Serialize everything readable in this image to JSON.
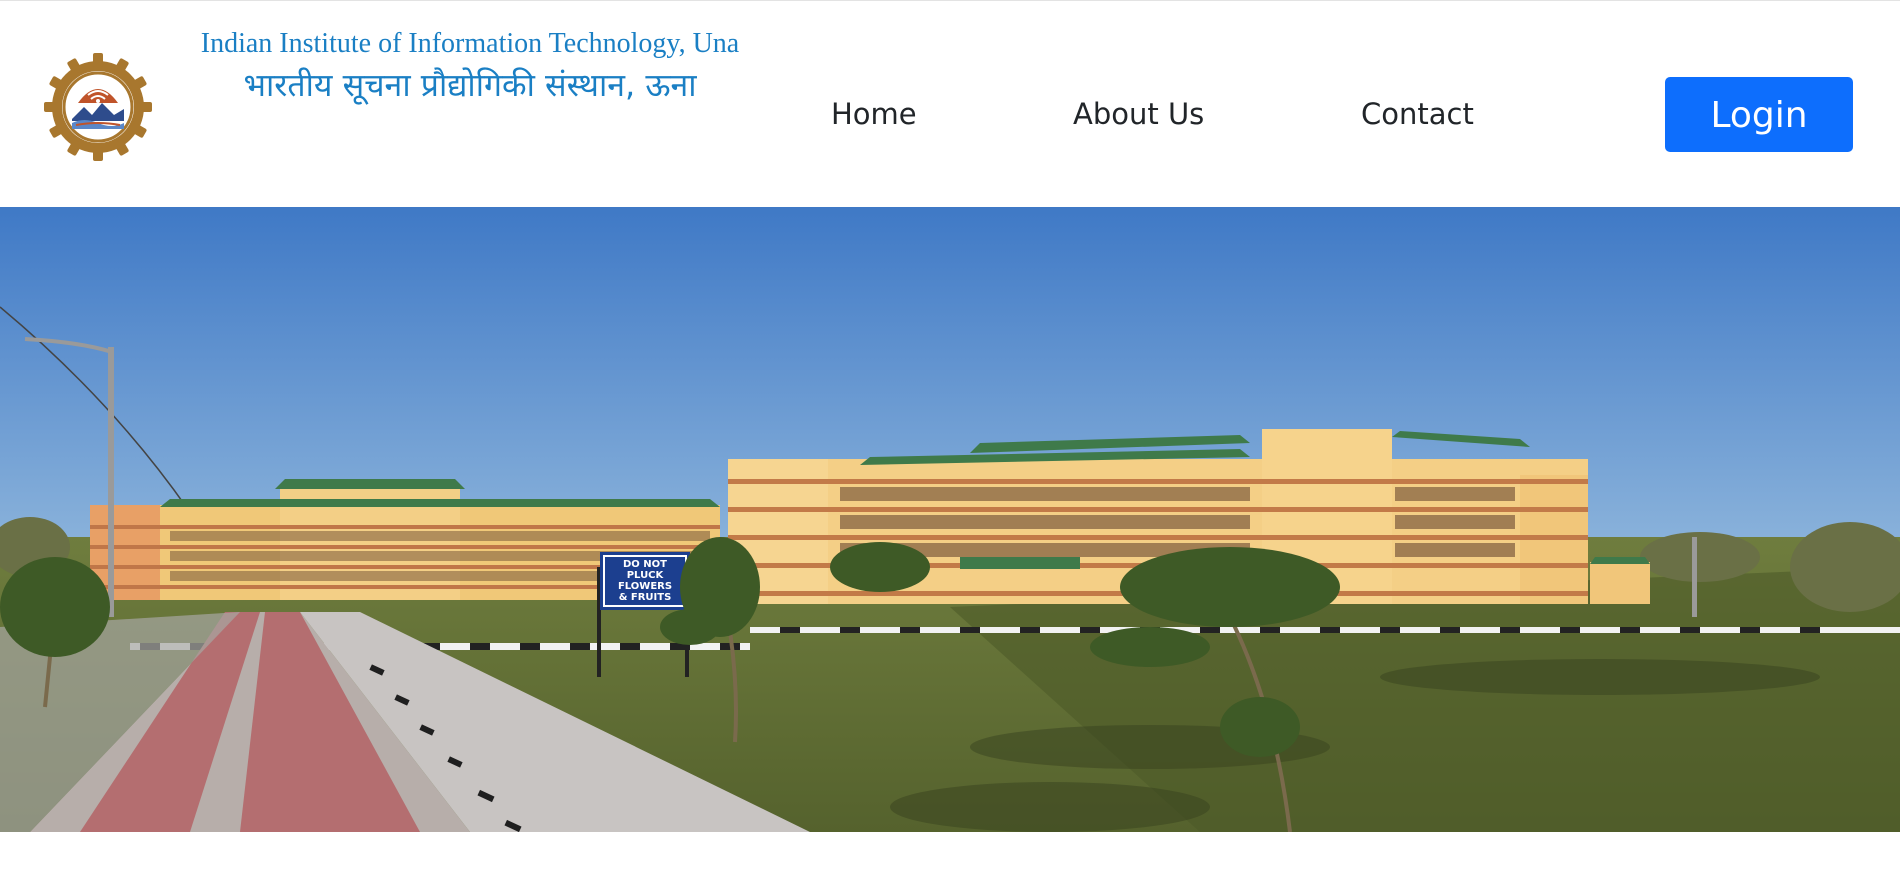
{
  "header": {
    "logo_icon": "institute-emblem",
    "institute_name_en": "Indian Institute of Information Technology, Una",
    "institute_name_hi": "भारतीय सूचना प्रौद्योगिकी संस्थान, ऊना"
  },
  "nav": {
    "items": [
      {
        "label": "Home"
      },
      {
        "label": "About Us"
      },
      {
        "label": "Contact"
      }
    ],
    "login_label": "Login"
  },
  "hero": {
    "sign_text": [
      "DO NOT",
      "PLUCK",
      "FLOWERS",
      "& FRUITS"
    ]
  },
  "colors": {
    "brand_text": "#1a7fc4",
    "login_button": "#0d6efd",
    "nav_text": "#212529"
  }
}
